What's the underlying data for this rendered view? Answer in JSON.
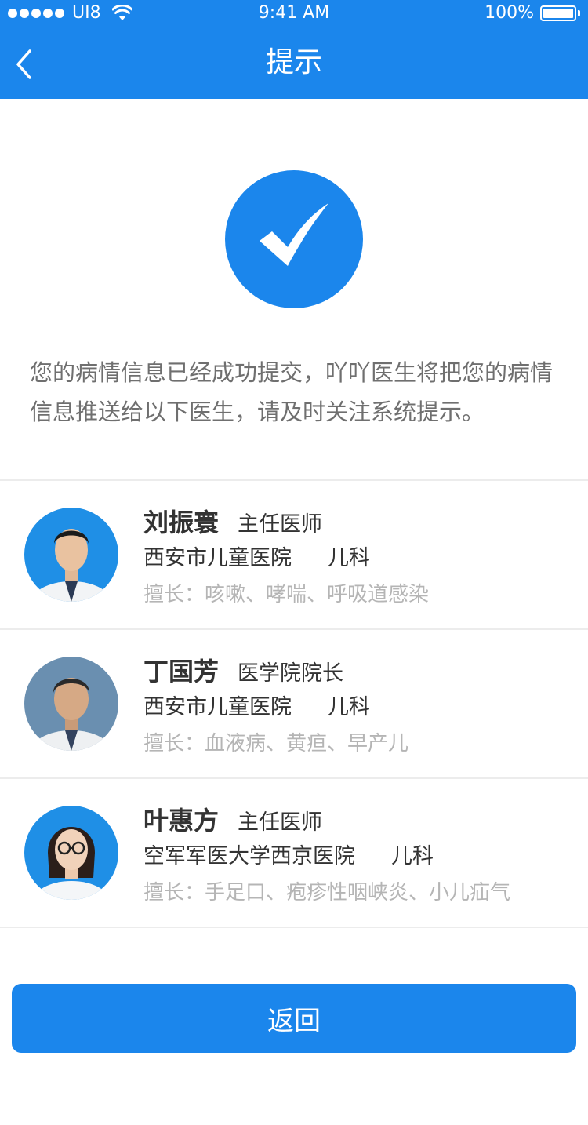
{
  "status_bar": {
    "carrier": "UI8",
    "time": "9:41 AM",
    "battery": "100%"
  },
  "nav": {
    "title": "提示",
    "back_icon": "chevron-left-icon"
  },
  "success_icon": "checkmark-icon",
  "message": "您的病情信息已经成功提交，吖吖医生将把您的病情信息推送给以下医生，请及时关注系统提示。",
  "doctors": [
    {
      "name": "刘振寰",
      "title": "主任医师",
      "hospital": "西安市儿童医院",
      "department": "儿科",
      "specialty_label": "擅长：",
      "specialty": "咳嗽、哮喘、呼吸道感染"
    },
    {
      "name": "丁国芳",
      "title": "医学院院长",
      "hospital": "西安市儿童医院",
      "department": "儿科",
      "specialty_label": "擅长：",
      "specialty": "血液病、黄疸、早产儿"
    },
    {
      "name": "叶惠方",
      "title": "主任医师",
      "hospital": "空军军医大学西京医院",
      "department": "儿科",
      "specialty_label": "擅长：",
      "specialty": "手足口、疱疹性咽峡炎、小儿疝气"
    }
  ],
  "return_button": "返回",
  "colors": {
    "primary": "#1b86ec",
    "text_dark": "#333333",
    "text_gray": "#6f6f6f",
    "text_light": "#b5b5b5",
    "divider": "#ececec"
  }
}
